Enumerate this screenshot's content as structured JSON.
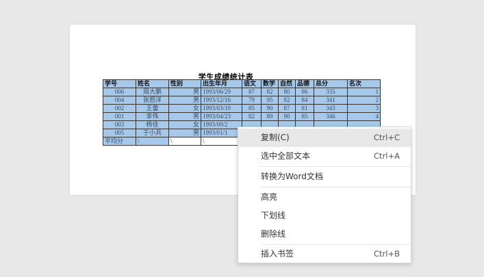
{
  "document": {
    "title": "学生成绩统计表",
    "columns": [
      "学号",
      "姓名",
      "性别",
      "出生年月",
      "语文",
      "数学",
      "自然",
      "品德",
      "总分",
      "名次"
    ],
    "rows": [
      [
        "006",
        "周大鹏",
        "男",
        "1993/06/29",
        "87",
        "82",
        "80",
        "86",
        "335",
        "1"
      ],
      [
        "004",
        "张怒洋",
        "男",
        "1993/12/16",
        "79",
        "95",
        "82",
        "84",
        "341",
        "2"
      ],
      [
        "002",
        "王蕾",
        "女",
        "1993/03/19",
        "85",
        "90",
        "87",
        "81",
        "343",
        "3"
      ],
      [
        "001",
        "李伟",
        "男",
        "1993/04/23",
        "82",
        "89",
        "90",
        "85",
        "346",
        "4"
      ],
      [
        "003",
        "杨佳",
        "女",
        "1993/09/2",
        ""
      ],
      [
        "005",
        "于小兵",
        "男",
        "1993/01/1",
        ""
      ]
    ],
    "average_row": [
      "平均分",
      "\\",
      "\\",
      "\\"
    ]
  },
  "context_menu": {
    "items": [
      {
        "label": "复制(C)",
        "shortcut": "Ctrl+C"
      },
      {
        "label": "选中全部文本",
        "shortcut": "Ctrl+A"
      },
      {
        "label": "转换为Word文档",
        "shortcut": ""
      },
      {
        "label": "高亮",
        "shortcut": ""
      },
      {
        "label": "下划线",
        "shortcut": ""
      },
      {
        "label": "删除线",
        "shortcut": ""
      },
      {
        "label": "插入书签",
        "shortcut": "Ctrl+B"
      }
    ]
  },
  "colors": {
    "selection": "#a6c8ea",
    "menu_hover": "#e8e8e8"
  }
}
